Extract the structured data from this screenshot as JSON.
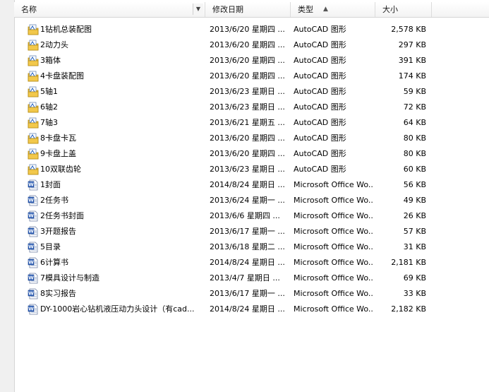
{
  "columns": {
    "name": "名称",
    "date": "修改日期",
    "type": "类型",
    "size": "大小"
  },
  "sort": {
    "column": "type",
    "direction": "ascending"
  },
  "files": [
    {
      "name": "1钻机总装配图",
      "date": "2013/6/20 星期四 ...",
      "type": "AutoCAD 图形",
      "size": "2,578 KB",
      "icon": "autocad-drawing-icon"
    },
    {
      "name": "2动力头",
      "date": "2013/6/20 星期四 ...",
      "type": "AutoCAD 图形",
      "size": "297 KB",
      "icon": "autocad-drawing-icon"
    },
    {
      "name": "3箱体",
      "date": "2013/6/20 星期四 ...",
      "type": "AutoCAD 图形",
      "size": "391 KB",
      "icon": "autocad-drawing-icon"
    },
    {
      "name": "4卡盘装配图",
      "date": "2013/6/20 星期四 ...",
      "type": "AutoCAD 图形",
      "size": "174 KB",
      "icon": "autocad-drawing-icon"
    },
    {
      "name": "5轴1",
      "date": "2013/6/23 星期日 ...",
      "type": "AutoCAD 图形",
      "size": "59 KB",
      "icon": "autocad-drawing-icon"
    },
    {
      "name": "6轴2",
      "date": "2013/6/23 星期日 ...",
      "type": "AutoCAD 图形",
      "size": "72 KB",
      "icon": "autocad-drawing-icon"
    },
    {
      "name": "7轴3",
      "date": "2013/6/21 星期五 ...",
      "type": "AutoCAD 图形",
      "size": "64 KB",
      "icon": "autocad-drawing-icon"
    },
    {
      "name": "8卡盘卡瓦",
      "date": "2013/6/20 星期四 ...",
      "type": "AutoCAD 图形",
      "size": "80 KB",
      "icon": "autocad-drawing-icon"
    },
    {
      "name": "9卡盘上盖",
      "date": "2013/6/20 星期四 ...",
      "type": "AutoCAD 图形",
      "size": "80 KB",
      "icon": "autocad-drawing-icon"
    },
    {
      "name": "10双联齿轮",
      "date": "2013/6/23 星期日 ...",
      "type": "AutoCAD 图形",
      "size": "60 KB",
      "icon": "autocad-drawing-icon"
    },
    {
      "name": "1封面",
      "date": "2014/8/24 星期日 ...",
      "type": "Microsoft Office Wo...",
      "size": "56 KB",
      "icon": "word-document-icon"
    },
    {
      "name": "2任务书",
      "date": "2013/6/24 星期一 ...",
      "type": "Microsoft Office Wo...",
      "size": "49 KB",
      "icon": "word-document-icon"
    },
    {
      "name": "2任务书封面",
      "date": "2013/6/6 星期四 ...",
      "type": "Microsoft Office Wo...",
      "size": "26 KB",
      "icon": "word-document-icon"
    },
    {
      "name": "3开题报告",
      "date": "2013/6/17 星期一 ...",
      "type": "Microsoft Office Wo...",
      "size": "57 KB",
      "icon": "word-document-icon"
    },
    {
      "name": "5目录",
      "date": "2013/6/18 星期二 ...",
      "type": "Microsoft Office Wo...",
      "size": "31 KB",
      "icon": "word-document-icon"
    },
    {
      "name": "6计算书",
      "date": "2014/8/24 星期日 ...",
      "type": "Microsoft Office Wo...",
      "size": "2,181 KB",
      "icon": "word-document-icon"
    },
    {
      "name": "7模具设计与制造",
      "date": "2013/4/7 星期日 ...",
      "type": "Microsoft Office Wo...",
      "size": "69 KB",
      "icon": "word-document-icon"
    },
    {
      "name": "8实习报告",
      "date": "2013/6/17 星期一 ...",
      "type": "Microsoft Office Wo...",
      "size": "33 KB",
      "icon": "word-document-icon"
    },
    {
      "name": "DY-1000岩心钻机液压动力头设计（有cad...",
      "date": "2014/8/24 星期日 ...",
      "type": "Microsoft Office Wo...",
      "size": "2,182 KB",
      "icon": "word-document-icon"
    }
  ]
}
